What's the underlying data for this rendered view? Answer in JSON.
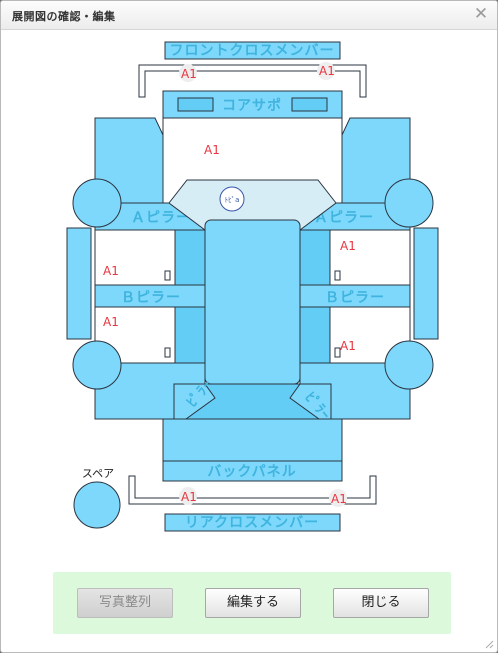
{
  "dialog": {
    "title": "展開図の確認・編集",
    "close_glyph": "✕"
  },
  "parts": {
    "front_cross_member": "フロントクロスメンバー",
    "core_support": "コアサポ",
    "a_pillar_left": "Ａピラー",
    "a_pillar_right": "Ａピラー",
    "b_pillar_left": "Ｂピラー",
    "b_pillar_right": "Ｂピラー",
    "back_panel": "バックパネル",
    "rear_cross_member": "リアクロスメンバー",
    "spare": "スペア",
    "badge": "ﾄﾋﾟa",
    "curve_left": "ﾋﾟﾗｰ",
    "curve_right": "ﾋﾟﾗｰ"
  },
  "marks": {
    "front_left": "A1",
    "front_right": "A1",
    "hood": "A1",
    "right_front_door": "A1",
    "left_front_door": "A1",
    "left_rear_door": "A1",
    "right_rear_door": "A1",
    "rear_left": "A1",
    "rear_right": "A1"
  },
  "buttons": {
    "photo_sort": "写真整列",
    "edit": "編集する",
    "close": "閉じる"
  },
  "colors": {
    "panel_fill": "#7ed8fb",
    "panel_stroke": "#2b3440",
    "label_color": "#3fb4de",
    "mark_color": "#e8353f",
    "footer_bg": "#dcfadb"
  }
}
